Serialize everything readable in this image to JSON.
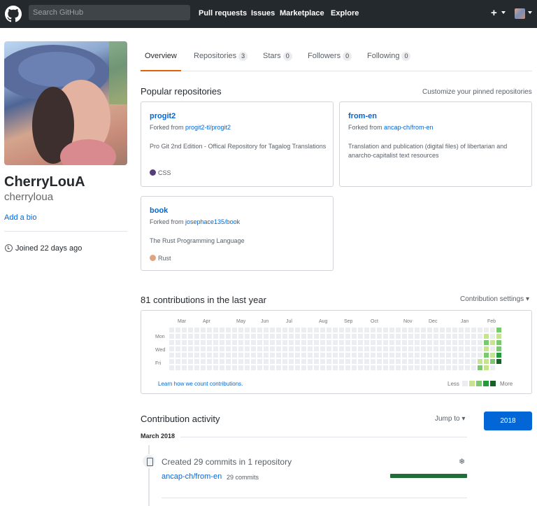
{
  "header": {
    "search_placeholder": "Search GitHub",
    "nav": [
      "Pull requests",
      "Issues",
      "Marketplace",
      "Explore"
    ],
    "plus": "+"
  },
  "profile": {
    "full_name": "CherryLouA",
    "username": "cherryloua",
    "add_bio": "Add a bio",
    "joined": "Joined 22 days ago"
  },
  "tabs": [
    {
      "label": "Overview",
      "count": null
    },
    {
      "label": "Repositories",
      "count": "3"
    },
    {
      "label": "Stars",
      "count": "0"
    },
    {
      "label": "Followers",
      "count": "0"
    },
    {
      "label": "Following",
      "count": "0"
    }
  ],
  "popular": {
    "title": "Popular repositories",
    "customize": "Customize your pinned repositories",
    "repos": [
      {
        "name": "progit2",
        "forked_prefix": "Forked from ",
        "forked_from": "progit2-tl/progit2",
        "description": "Pro Git 2nd Edition - Offical Repository for Tagalog Translations",
        "language": "CSS",
        "lang_color": "#563d7c"
      },
      {
        "name": "from-en",
        "forked_prefix": "Forked from ",
        "forked_from": "ancap-ch/from-en",
        "description": "Translation and publication (digital files) of libertarian and anarcho-capitalist text resources",
        "language": "",
        "lang_color": ""
      },
      {
        "name": "book",
        "forked_prefix": "Forked from ",
        "forked_from": "josephace135/book",
        "description": "The Rust Programming Language",
        "language": "Rust",
        "lang_color": "#dea584"
      }
    ]
  },
  "contributions": {
    "title": "81 contributions in the last year",
    "settings": "Contribution settings",
    "months": [
      "Mar",
      "Apr",
      "May",
      "Jun",
      "Jul",
      "Aug",
      "Sep",
      "Oct",
      "Nov",
      "Dec",
      "Jan",
      "Feb"
    ],
    "days": [
      "Mon",
      "Wed",
      "Fri"
    ],
    "learn": "Learn how we count contributions.",
    "less": "Less",
    "more": "More",
    "colors": [
      "#ebedf0",
      "#c6e48b",
      "#7bc96f",
      "#239a3b",
      "#196127"
    ],
    "recent_weeks": [
      [
        0,
        0,
        0,
        0,
        0,
        1,
        2
      ],
      [
        0,
        1,
        2,
        1,
        2,
        1,
        1
      ],
      [
        0,
        0,
        1,
        0,
        1,
        2,
        0
      ],
      [
        2,
        1,
        2,
        2,
        3,
        4,
        0
      ]
    ]
  },
  "activity": {
    "title": "Contribution activity",
    "jump": "Jump to",
    "year": "2018",
    "month": "March 2018",
    "summary": "Created 29 commits in 1 repository",
    "repo": "ancap-ch/from-en",
    "repo_commits": "29 commits",
    "progress": 1.0,
    "collapse_glyph": "❄"
  }
}
